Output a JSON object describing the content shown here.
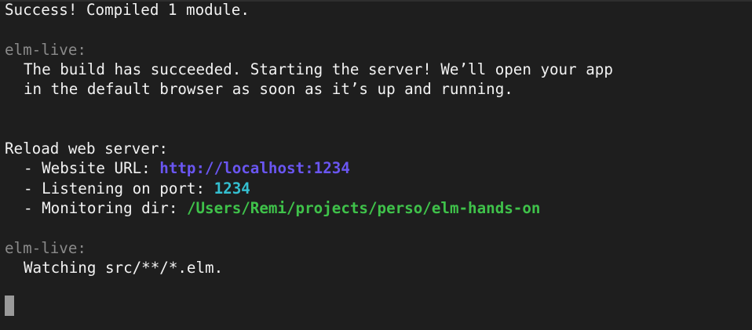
{
  "terminal": {
    "compile_success": "Success! Compiled 1 module.",
    "block1": {
      "tag": "elm-live:",
      "line1": "The build has succeeded. Starting the server! We’ll open your app",
      "line2": "in the default browser as soon as it’s up and running."
    },
    "reload": {
      "header": "Reload web server:",
      "website_label": "- Website URL: ",
      "website_url": "http://localhost:1234",
      "port_label": "- Listening on port: ",
      "port_value": "1234",
      "dir_label": "- Monitoring dir: ",
      "dir_value": "/Users/Remi/projects/perso/elm-hands-on"
    },
    "block2": {
      "tag": "elm-live:",
      "line1": "Watching src/**/*.elm."
    }
  },
  "colors": {
    "background": "#1e1e1e",
    "text": "#f2f2f2",
    "dim": "#8a8a8a",
    "url": "#6a56f2",
    "port": "#34bfd0",
    "dir": "#3fc24a",
    "cursor": "#9a9a9a"
  }
}
